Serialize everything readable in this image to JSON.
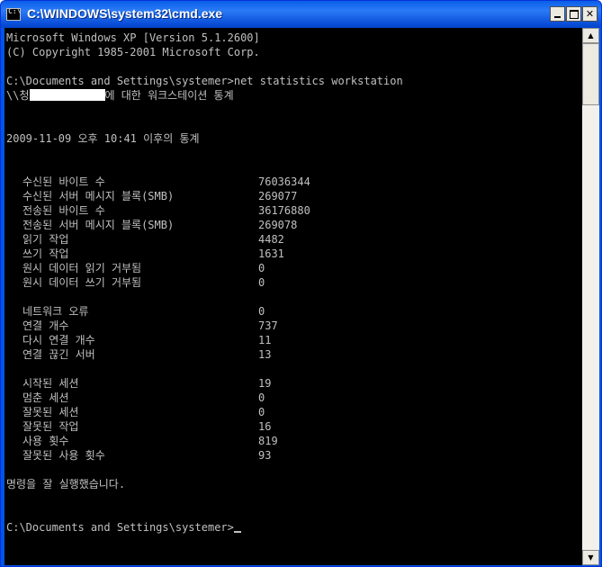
{
  "window": {
    "title": "C:\\WINDOWS\\system32\\cmd.exe",
    "icon_text": "C:\\"
  },
  "console": {
    "header_line1": "Microsoft Windows XP [Version 5.1.2600]",
    "header_line2": "(C) Copyright 1985-2001 Microsoft Corp.",
    "command_line": "C:\\Documents and Settings\\systemer>net statistics workstation",
    "subtitle_prefix": "\\\\청",
    "subtitle_suffix": "에 대한 워크스테이션 통계",
    "since_line": "2009-11-09 오후 10:41 이후의 통계",
    "stats": [
      {
        "label": "수신된 바이트 수",
        "value": "76036344"
      },
      {
        "label": "수신된 서버 메시지 블록(SMB)",
        "value": "269077"
      },
      {
        "label": "전송된 바이트 수",
        "value": "36176880"
      },
      {
        "label": "전송된 서버 메시지 블록(SMB)",
        "value": "269078"
      },
      {
        "label": "읽기 작업",
        "value": "4482"
      },
      {
        "label": "쓰기 작업",
        "value": "1631"
      },
      {
        "label": "원시 데이터 읽기 거부됨",
        "value": "0"
      },
      {
        "label": "원시 데이터 쓰기 거부됨",
        "value": "0"
      },
      {
        "label": "네트워크 오류",
        "value": "0"
      },
      {
        "label": "연결 개수",
        "value": "737"
      },
      {
        "label": "다시 연결 개수",
        "value": "11"
      },
      {
        "label": "연결 끊긴 서버",
        "value": "13"
      },
      {
        "label": "시작된 세션",
        "value": "19"
      },
      {
        "label": "멈춘 세션",
        "value": "0"
      },
      {
        "label": "잘못된 세션",
        "value": "0"
      },
      {
        "label": "잘못된 작업",
        "value": "16"
      },
      {
        "label": "사용 횟수",
        "value": "819"
      },
      {
        "label": "잘못된 사용 횟수",
        "value": "93"
      }
    ],
    "success_line": "명령을 잘 실행했습니다.",
    "prompt_line": "C:\\Documents and Settings\\systemer>"
  },
  "colors": {
    "console_bg": "#000000",
    "console_text": "#c0c0c0",
    "titlebar": "#0a5ee8"
  }
}
